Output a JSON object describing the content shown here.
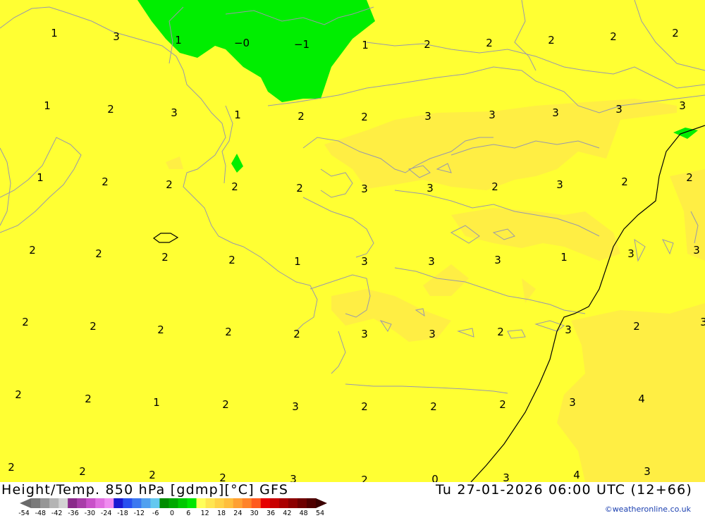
{
  "map": {
    "title": "Height/Temp. 850 hPa [gdmp][°C] GFS",
    "valid_time": "Tu 27-01-2026 06:00 UTC (12+66)",
    "credit": "©weatheronline.co.uk",
    "colors": {
      "base": "#ffff33",
      "warm_shade": "#ffee44",
      "cold_green": "#00ee00",
      "coastline": "#9999aa",
      "contour": "#000000"
    },
    "contour_labels": [
      {
        "text": "1"
      },
      {
        "text": "3"
      },
      {
        "text": "1"
      },
      {
        "text": "−0"
      },
      {
        "text": "−1"
      },
      {
        "text": "1"
      },
      {
        "text": "2"
      },
      {
        "text": "2"
      },
      {
        "text": "2"
      },
      {
        "text": "2"
      },
      {
        "text": "2"
      },
      {
        "text": "1"
      },
      {
        "text": "2"
      },
      {
        "text": "3"
      },
      {
        "text": "1"
      },
      {
        "text": "2"
      },
      {
        "text": "2"
      },
      {
        "text": "3"
      },
      {
        "text": "3"
      },
      {
        "text": "3"
      },
      {
        "text": "3"
      },
      {
        "text": "3"
      },
      {
        "text": "1"
      },
      {
        "text": "2"
      },
      {
        "text": "2"
      },
      {
        "text": "2"
      },
      {
        "text": "2"
      },
      {
        "text": "3"
      },
      {
        "text": "3"
      },
      {
        "text": "2"
      },
      {
        "text": "3"
      },
      {
        "text": "2"
      },
      {
        "text": "2"
      },
      {
        "text": "2"
      },
      {
        "text": "2"
      },
      {
        "text": "2"
      },
      {
        "text": "2"
      },
      {
        "text": "1"
      },
      {
        "text": "3"
      },
      {
        "text": "3"
      },
      {
        "text": "3"
      },
      {
        "text": "1"
      },
      {
        "text": "3"
      },
      {
        "text": "3"
      },
      {
        "text": "2"
      },
      {
        "text": "2"
      },
      {
        "text": "2"
      },
      {
        "text": "2"
      },
      {
        "text": "2"
      },
      {
        "text": "3"
      },
      {
        "text": "3"
      },
      {
        "text": "2"
      },
      {
        "text": "3"
      },
      {
        "text": "2"
      },
      {
        "text": "3"
      },
      {
        "text": "2"
      },
      {
        "text": "2"
      },
      {
        "text": "1"
      },
      {
        "text": "2"
      },
      {
        "text": "3"
      },
      {
        "text": "2"
      },
      {
        "text": "2"
      },
      {
        "text": "2"
      },
      {
        "text": "3"
      },
      {
        "text": "4"
      },
      {
        "text": "2"
      },
      {
        "text": "2"
      },
      {
        "text": "2"
      },
      {
        "text": "2"
      },
      {
        "text": "3"
      },
      {
        "text": "2"
      },
      {
        "text": "0"
      },
      {
        "text": "3"
      },
      {
        "text": "4"
      },
      {
        "text": "3"
      }
    ]
  },
  "legend": {
    "colors": [
      "#7a7a7a",
      "#969696",
      "#b4b4b4",
      "#d2d2d2",
      "#8a2a8a",
      "#a83ca8",
      "#c850c8",
      "#e06ee0",
      "#f08cf0",
      "#1a1ad2",
      "#2850f0",
      "#3c78f0",
      "#50a0f0",
      "#64c8f0",
      "#008c00",
      "#00a800",
      "#00c800",
      "#00e600",
      "#ffff5a",
      "#ffe650",
      "#ffd246",
      "#ffbe3c",
      "#ffa032",
      "#ff8228",
      "#ff5a1e",
      "#e60000",
      "#c80000",
      "#aa0000",
      "#8c0000",
      "#6e0000",
      "#500000"
    ],
    "tick_labels": [
      "-54",
      "-48",
      "-42",
      "-36",
      "-30",
      "-24",
      "-18",
      "-12",
      "-6",
      "0",
      "6",
      "12",
      "18",
      "24",
      "30",
      "36",
      "42",
      "48",
      "54"
    ]
  }
}
